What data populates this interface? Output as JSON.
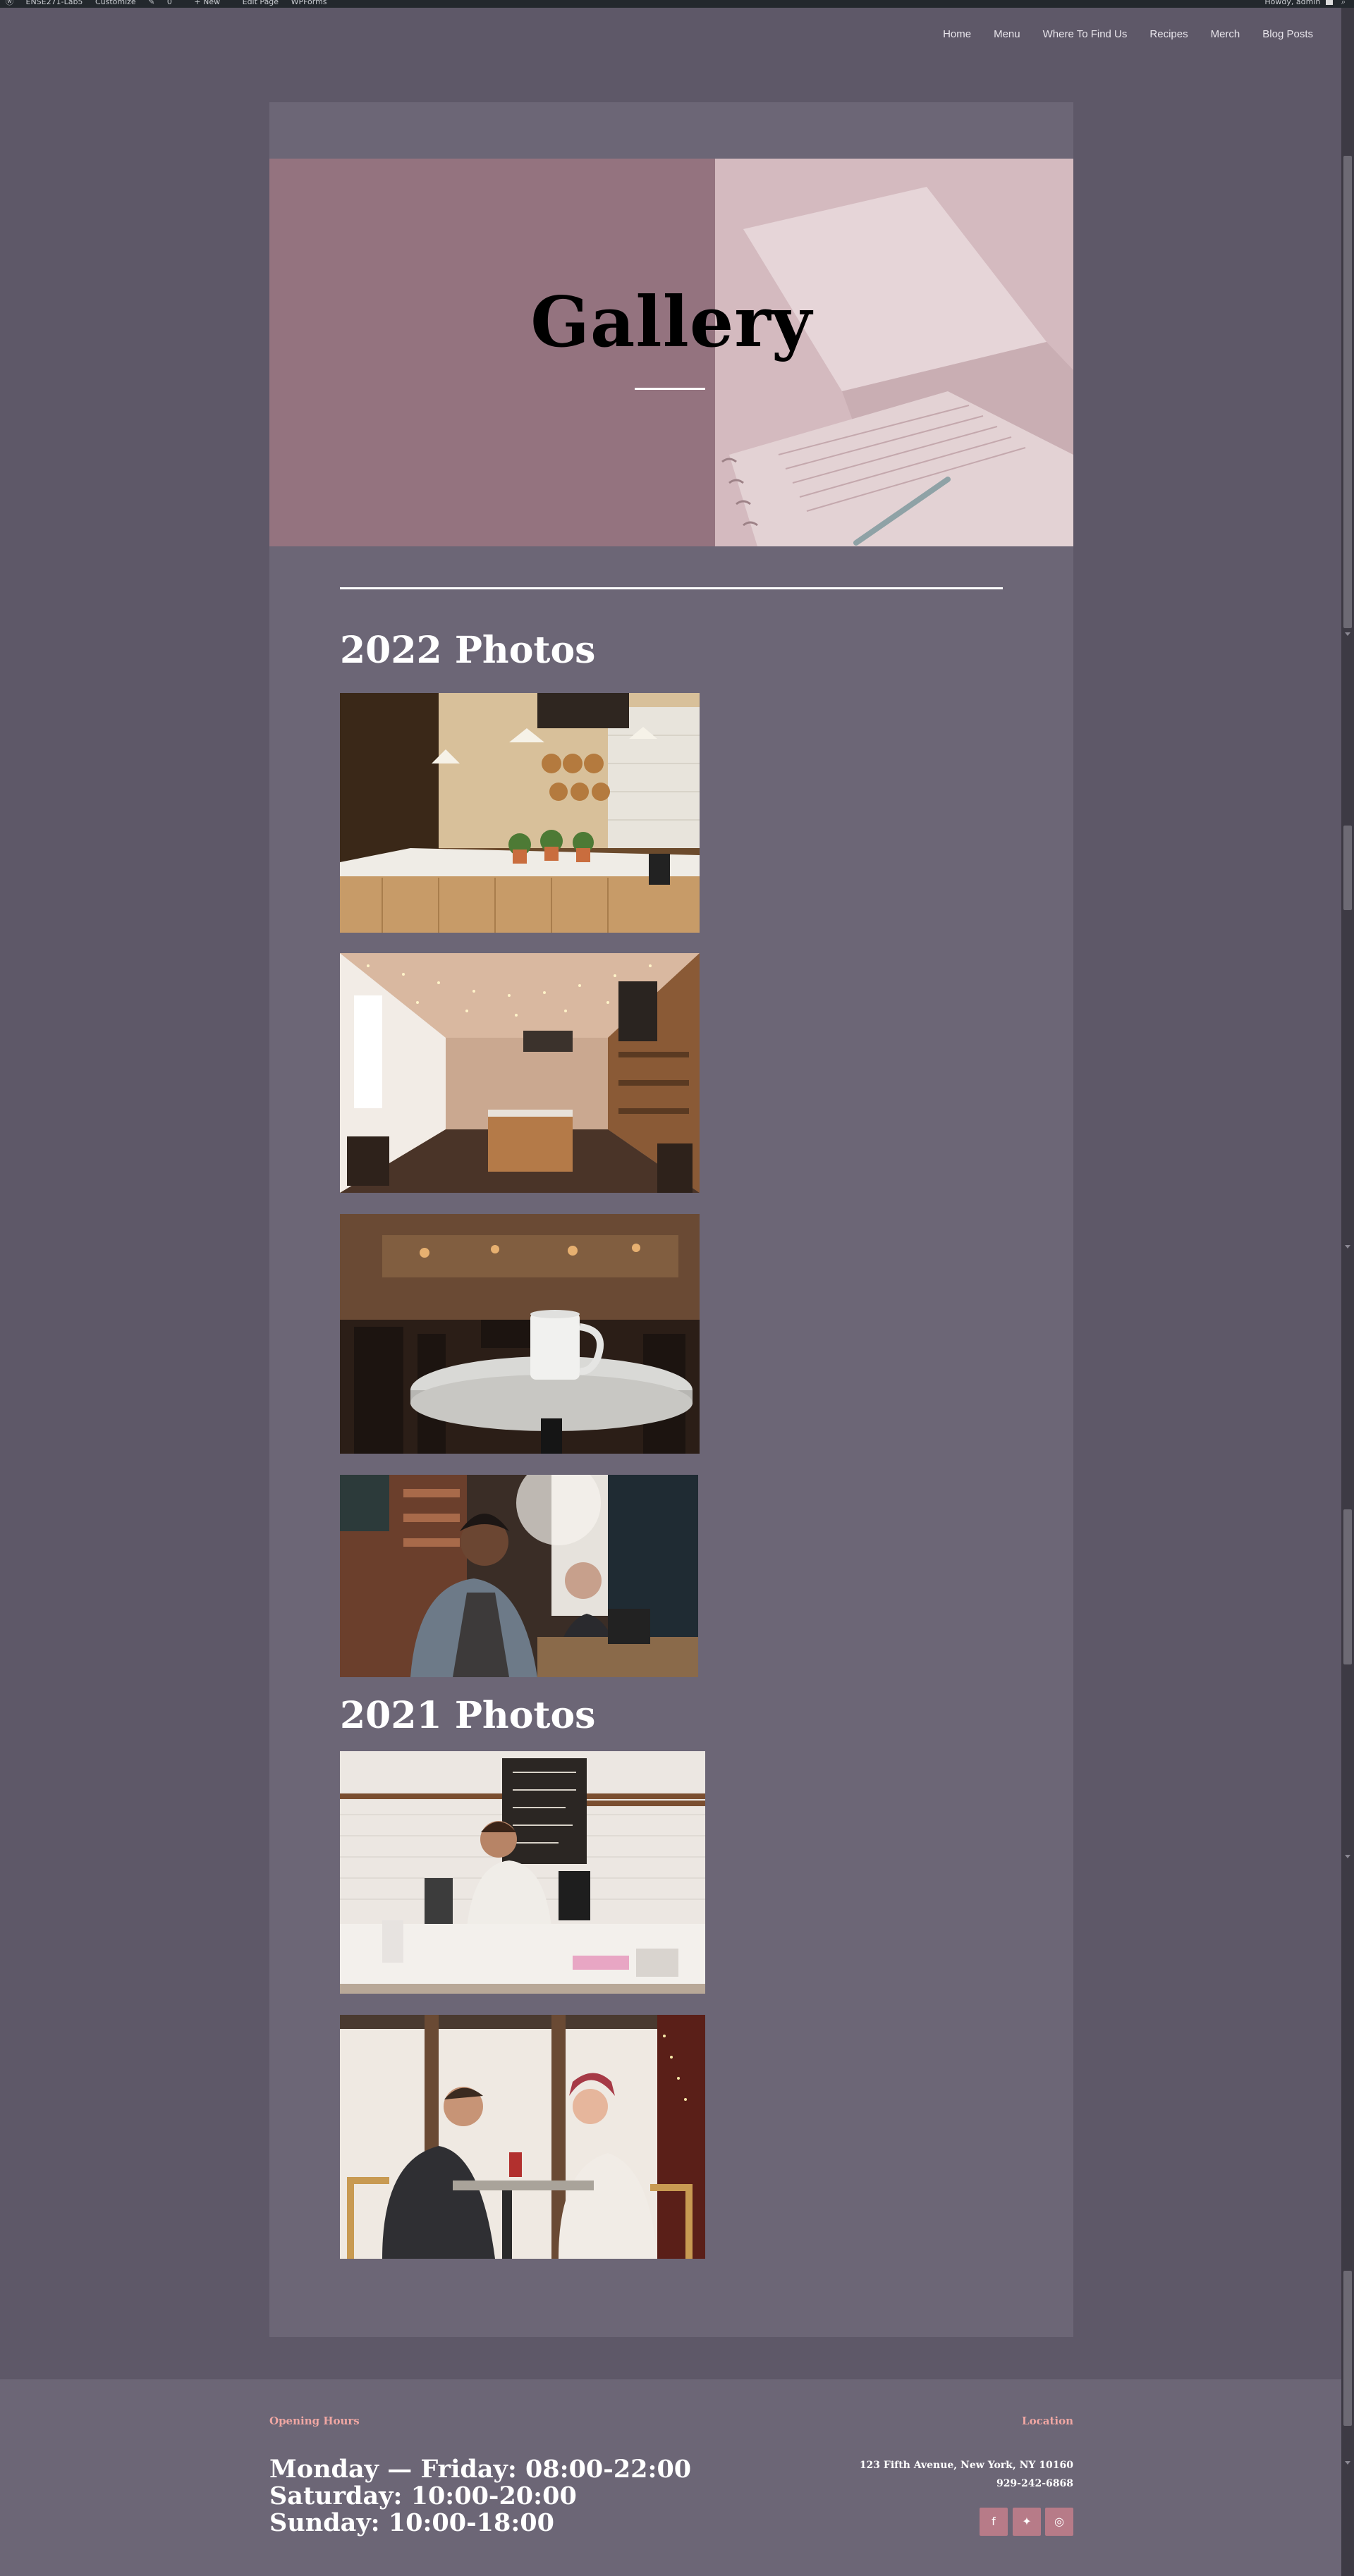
{
  "adminbar": {
    "site_name": "ENSE271-Lab5",
    "customize": "Customize",
    "comments_count": "0",
    "new_label": "New",
    "edit_page": "Edit Page",
    "wpforms": "WPForms",
    "howdy": "Howdy, admin"
  },
  "nav": {
    "items": [
      "Home",
      "Menu",
      "Where To Find Us",
      "Recipes",
      "Merch",
      "Blog Posts"
    ]
  },
  "hero": {
    "title": "Gallery"
  },
  "sections": [
    {
      "heading": "2022 Photos",
      "photos": [
        "bakery counter",
        "cafe interior with string lights",
        "coffee cup on marble table",
        "barista taking order"
      ]
    },
    {
      "heading": "2021 Photos",
      "photos": [
        "smiling barista behind counter",
        "couple chatting at cafe table"
      ]
    }
  ],
  "footer": {
    "hours_heading": "Opening Hours",
    "hours": [
      "Monday — Friday: 08:00-22:00",
      "Saturday: 10:00-20:00",
      "Sunday: 10:00-18:00"
    ],
    "location_heading": "Location",
    "address": "123 Fifth Avenue, New York, NY 10160",
    "phone": "929-242-6868",
    "social_icons": [
      "facebook-icon",
      "twitter-icon",
      "instagram-icon"
    ]
  },
  "colors": {
    "page_bg": "#5e5868",
    "card_bg": "#6c6676",
    "hero_mauve": "#94737f",
    "accent_pink": "#f0a7a3",
    "social_bg": "#b77b88"
  }
}
